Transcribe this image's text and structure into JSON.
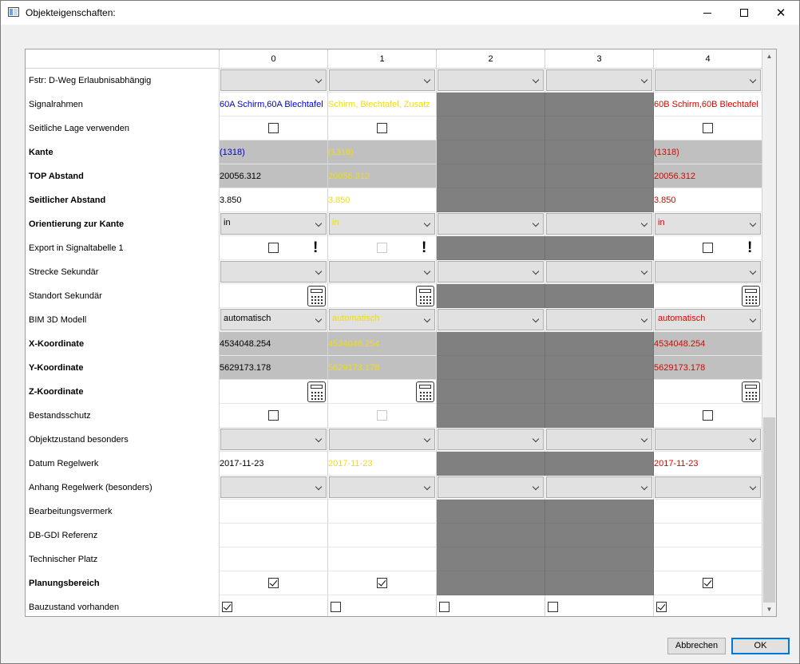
{
  "window": {
    "title": "Objekteigenschaften:",
    "controls": {
      "minimize": "minimize-icon",
      "maximize": "maximize-icon",
      "close": "close-icon"
    }
  },
  "grid": {
    "columns": [
      "0",
      "1",
      "2",
      "3",
      "4"
    ],
    "rows": [
      {
        "label": "Fstr: D-Weg Erlaubnisabhängig",
        "bold": false,
        "cells": [
          {
            "type": "combo",
            "text": ""
          },
          {
            "type": "combo",
            "text": ""
          },
          {
            "type": "combo",
            "text": ""
          },
          {
            "type": "combo",
            "text": ""
          },
          {
            "type": "combo",
            "text": ""
          }
        ]
      },
      {
        "label": "Signalrahmen",
        "bold": false,
        "cells": [
          {
            "type": "text",
            "text": " 60A Schirm,60A Blechtafel",
            "color": "blue"
          },
          {
            "type": "text",
            "text": "Schirm, Blechtafel, Zusatz",
            "color": "yellow"
          },
          {
            "type": "disabled"
          },
          {
            "type": "disabled"
          },
          {
            "type": "text",
            "text": "60B Schirm,60B Blechtafel",
            "color": "red"
          }
        ]
      },
      {
        "label": "Seitliche Lage verwenden",
        "bold": false,
        "cells": [
          {
            "type": "check",
            "checked": false
          },
          {
            "type": "check",
            "checked": false
          },
          {
            "type": "disabled"
          },
          {
            "type": "disabled"
          },
          {
            "type": "check",
            "checked": false
          }
        ]
      },
      {
        "label": "Kante",
        "bold": true,
        "cells": [
          {
            "type": "text",
            "text": "(1318)",
            "color": "blue",
            "bg": "gray"
          },
          {
            "type": "text",
            "text": "(1318)",
            "color": "yellow",
            "bg": "gray"
          },
          {
            "type": "disabled"
          },
          {
            "type": "disabled"
          },
          {
            "type": "text",
            "text": "(1318)",
            "color": "red",
            "bg": "gray"
          }
        ]
      },
      {
        "label": "TOP Abstand",
        "bold": true,
        "cells": [
          {
            "type": "text",
            "text": "20056.312",
            "color": "black",
            "bg": "gray"
          },
          {
            "type": "text",
            "text": "20056.312",
            "color": "yellow",
            "bg": "gray"
          },
          {
            "type": "disabled"
          },
          {
            "type": "disabled"
          },
          {
            "type": "text",
            "text": "20056.312",
            "color": "red",
            "bg": "gray"
          }
        ]
      },
      {
        "label": "Seitlicher Abstand",
        "bold": true,
        "cells": [
          {
            "type": "text",
            "text": "3.850",
            "color": "black"
          },
          {
            "type": "text",
            "text": "3.850",
            "color": "yellow"
          },
          {
            "type": "disabled"
          },
          {
            "type": "disabled"
          },
          {
            "type": "text",
            "text": "3.850",
            "color": "red"
          }
        ]
      },
      {
        "label": "Orientierung zur Kante",
        "bold": true,
        "cells": [
          {
            "type": "combo",
            "text": "in",
            "color": "black"
          },
          {
            "type": "combo",
            "text": "in",
            "color": "yellow"
          },
          {
            "type": "combo",
            "text": ""
          },
          {
            "type": "combo",
            "text": ""
          },
          {
            "type": "combo",
            "text": "in",
            "color": "red"
          }
        ]
      },
      {
        "label": "Export in Signaltabelle 1",
        "bold": false,
        "cells": [
          {
            "type": "checkwarn",
            "checked": false,
            "warn": "!"
          },
          {
            "type": "checkwarn",
            "checked": false,
            "warn": "!",
            "faint": true
          },
          {
            "type": "disabled"
          },
          {
            "type": "disabled"
          },
          {
            "type": "checkwarn",
            "checked": false,
            "warn": "!"
          }
        ]
      },
      {
        "label": "Strecke Sekundär",
        "bold": false,
        "cells": [
          {
            "type": "combo",
            "text": ""
          },
          {
            "type": "combo",
            "text": ""
          },
          {
            "type": "combo",
            "text": ""
          },
          {
            "type": "combo",
            "text": ""
          },
          {
            "type": "combo",
            "text": ""
          }
        ]
      },
      {
        "label": "Standort Sekundär",
        "bold": false,
        "cells": [
          {
            "type": "calc"
          },
          {
            "type": "calc"
          },
          {
            "type": "disabled"
          },
          {
            "type": "disabled"
          },
          {
            "type": "calc"
          }
        ]
      },
      {
        "label": "BIM 3D Modell",
        "bold": false,
        "cells": [
          {
            "type": "combo",
            "text": "automatisch",
            "color": "black"
          },
          {
            "type": "combo",
            "text": "automatisch",
            "color": "yellow"
          },
          {
            "type": "combo",
            "text": ""
          },
          {
            "type": "combo",
            "text": ""
          },
          {
            "type": "combo",
            "text": "automatisch",
            "color": "red"
          }
        ]
      },
      {
        "label": "X-Koordinate",
        "bold": true,
        "cells": [
          {
            "type": "text",
            "text": "4534048.254",
            "color": "black",
            "bg": "gray"
          },
          {
            "type": "text",
            "text": "4534048.254",
            "color": "yellow",
            "bg": "gray"
          },
          {
            "type": "disabled"
          },
          {
            "type": "disabled"
          },
          {
            "type": "text",
            "text": "4534048.254",
            "color": "red",
            "bg": "gray"
          }
        ]
      },
      {
        "label": "Y-Koordinate",
        "bold": true,
        "cells": [
          {
            "type": "text",
            "text": "5629173.178",
            "color": "black",
            "bg": "gray"
          },
          {
            "type": "text",
            "text": "5629173.178",
            "color": "yellow",
            "bg": "gray"
          },
          {
            "type": "disabled"
          },
          {
            "type": "disabled"
          },
          {
            "type": "text",
            "text": "5629173.178",
            "color": "red",
            "bg": "gray"
          }
        ]
      },
      {
        "label": "Z-Koordinate",
        "bold": true,
        "cells": [
          {
            "type": "calc"
          },
          {
            "type": "calc"
          },
          {
            "type": "disabled"
          },
          {
            "type": "disabled"
          },
          {
            "type": "calc"
          }
        ]
      },
      {
        "label": "Bestandsschutz",
        "bold": false,
        "cells": [
          {
            "type": "check",
            "checked": false
          },
          {
            "type": "check",
            "checked": false,
            "faint": true
          },
          {
            "type": "disabled"
          },
          {
            "type": "disabled"
          },
          {
            "type": "check",
            "checked": false
          }
        ]
      },
      {
        "label": "Objektzustand besonders",
        "bold": false,
        "cells": [
          {
            "type": "combo",
            "text": ""
          },
          {
            "type": "combo",
            "text": ""
          },
          {
            "type": "combo",
            "text": ""
          },
          {
            "type": "combo",
            "text": ""
          },
          {
            "type": "combo",
            "text": ""
          }
        ]
      },
      {
        "label": "Datum Regelwerk",
        "bold": false,
        "cells": [
          {
            "type": "text",
            "text": "2017-11-23",
            "color": "black"
          },
          {
            "type": "text",
            "text": "2017-11-23",
            "color": "yellow"
          },
          {
            "type": "disabled"
          },
          {
            "type": "disabled"
          },
          {
            "type": "text",
            "text": "2017-11-23",
            "color": "red"
          }
        ]
      },
      {
        "label": "Anhang Regelwerk (besonders)",
        "bold": false,
        "cells": [
          {
            "type": "combo",
            "text": ""
          },
          {
            "type": "combo",
            "text": ""
          },
          {
            "type": "combo",
            "text": ""
          },
          {
            "type": "combo",
            "text": ""
          },
          {
            "type": "combo",
            "text": ""
          }
        ]
      },
      {
        "label": "Bearbeitungsvermerk",
        "bold": false,
        "cells": [
          {
            "type": "empty"
          },
          {
            "type": "empty"
          },
          {
            "type": "disabled"
          },
          {
            "type": "disabled"
          },
          {
            "type": "empty"
          }
        ]
      },
      {
        "label": "DB-GDI Referenz",
        "bold": false,
        "cells": [
          {
            "type": "empty"
          },
          {
            "type": "empty"
          },
          {
            "type": "disabled"
          },
          {
            "type": "disabled"
          },
          {
            "type": "empty"
          }
        ]
      },
      {
        "label": "Technischer Platz",
        "bold": false,
        "cells": [
          {
            "type": "empty"
          },
          {
            "type": "empty"
          },
          {
            "type": "disabled"
          },
          {
            "type": "disabled"
          },
          {
            "type": "empty"
          }
        ]
      },
      {
        "label": "Planungsbereich",
        "bold": true,
        "cells": [
          {
            "type": "check",
            "checked": true
          },
          {
            "type": "check",
            "checked": true
          },
          {
            "type": "disabled"
          },
          {
            "type": "disabled"
          },
          {
            "type": "check",
            "checked": true
          }
        ]
      },
      {
        "label": "Bauzustand vorhanden",
        "bold": false,
        "cells": [
          {
            "type": "checkleft",
            "checked": true
          },
          {
            "type": "checkleft",
            "checked": false
          },
          {
            "type": "checkleft",
            "checked": false
          },
          {
            "type": "checkleft",
            "checked": false
          },
          {
            "type": "checkleft",
            "checked": true
          }
        ]
      }
    ]
  },
  "buttons": {
    "cancel": "Abbrechen",
    "ok": "OK"
  },
  "colors": {
    "blue": "#0000e0",
    "yellow": "#f0e000",
    "red": "#e00000",
    "black": "#000000",
    "disabled": "#808080",
    "readonly": "#c0c0c0"
  }
}
